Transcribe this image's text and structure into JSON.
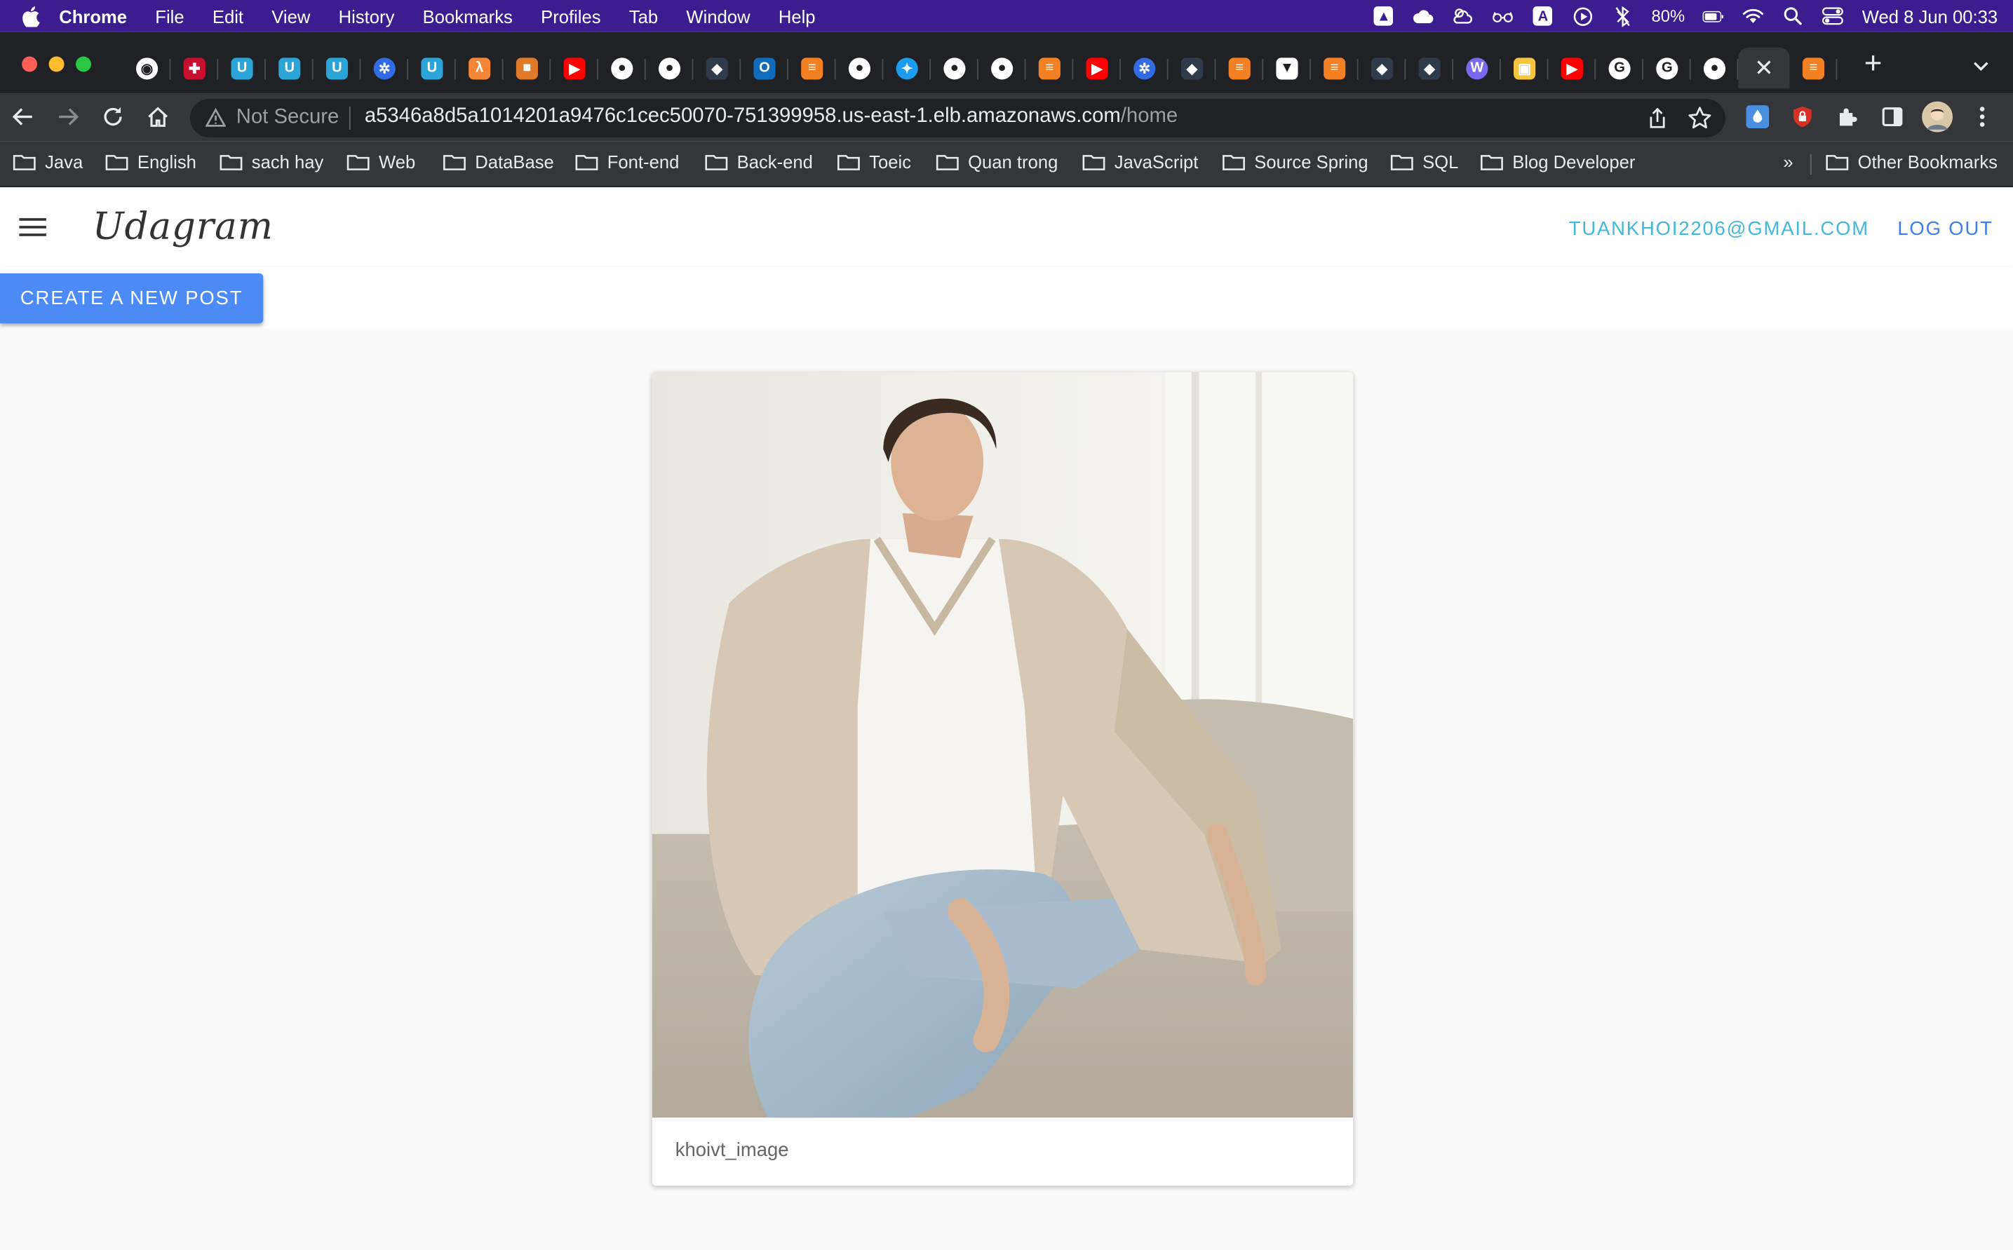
{
  "menubar": {
    "app": "Chrome",
    "items": [
      "File",
      "Edit",
      "View",
      "History",
      "Bookmarks",
      "Profiles",
      "Tab",
      "Window",
      "Help"
    ],
    "battery": "80%",
    "datetime": "Wed 8 Jun  00:33"
  },
  "tabs": [
    {
      "icon": "chrome-icon",
      "color": "#ffffff"
    },
    {
      "icon": "uk-flag-icon",
      "color": "#c8102e"
    },
    {
      "icon": "udacity-icon",
      "color": "#2ba4d8"
    },
    {
      "icon": "udacity-icon",
      "color": "#2ba4d8"
    },
    {
      "icon": "udacity-icon",
      "color": "#2ba4d8"
    },
    {
      "icon": "kubernetes-icon",
      "color": "#326ce5"
    },
    {
      "icon": "udacity-icon",
      "color": "#2ba4d8"
    },
    {
      "icon": "aws-lambda-icon",
      "color": "#f58536"
    },
    {
      "icon": "aws-box-icon",
      "color": "#e07a2b"
    },
    {
      "icon": "youtube-icon",
      "color": "#ff0000"
    },
    {
      "icon": "github-icon",
      "color": "#ffffff"
    },
    {
      "icon": "github-icon",
      "color": "#ffffff"
    },
    {
      "icon": "docker-icon",
      "color": "#2f3b4a"
    },
    {
      "icon": "outlook-icon",
      "color": "#0f6cbd"
    },
    {
      "icon": "stackoverflow-icon",
      "color": "#f48024"
    },
    {
      "icon": "github-icon",
      "color": "#ffffff"
    },
    {
      "icon": "bird-icon",
      "color": "#1d9bf0"
    },
    {
      "icon": "github-icon",
      "color": "#ffffff"
    },
    {
      "icon": "github-icon",
      "color": "#ffffff"
    },
    {
      "icon": "stackoverflow-icon",
      "color": "#f48024"
    },
    {
      "icon": "youtube-icon",
      "color": "#ff0000"
    },
    {
      "icon": "kubernetes-icon",
      "color": "#326ce5"
    },
    {
      "icon": "docker-icon",
      "color": "#2f3b4a"
    },
    {
      "icon": "stackoverflow-icon",
      "color": "#f48024"
    },
    {
      "icon": "vercel-icon",
      "color": "#ffffff"
    },
    {
      "icon": "stackoverflow-icon",
      "color": "#f48024"
    },
    {
      "icon": "docker-icon",
      "color": "#2f3b4a"
    },
    {
      "icon": "docker-icon",
      "color": "#2f3b4a"
    },
    {
      "icon": "wordpress-icon",
      "color": "#7b68ee"
    },
    {
      "icon": "package-icon",
      "color": "#f5c542"
    },
    {
      "icon": "youtube-icon",
      "color": "#ff0000"
    },
    {
      "icon": "google-icon",
      "color": "#ffffff"
    },
    {
      "icon": "google-icon",
      "color": "#ffffff"
    },
    {
      "icon": "github-icon",
      "color": "#ffffff"
    },
    {
      "icon": "close-icon",
      "color": "#e8eaed",
      "active": true
    },
    {
      "icon": "stackoverflow-icon",
      "color": "#f48024"
    }
  ],
  "address_bar": {
    "security": "Not Secure",
    "host": "a5346a8d5a1014201a9476c1cec50070-751399958.us-east-1.elb.amazonaws.com",
    "path": "/home"
  },
  "bookmarks": [
    "Java",
    "English",
    "sach hay",
    "Web",
    "DataBase",
    "Font-end",
    "Back-end",
    "Toeic",
    "Quan trong",
    "JavaScript",
    "Source Spring",
    "SQL",
    "Blog Developer"
  ],
  "bookmarks_more": "»",
  "bookmarks_other": "Other Bookmarks",
  "app": {
    "brand": "Udagram",
    "user_email": "TUANKHOI2206@GMAIL.COM",
    "logout_label": "LOG OUT",
    "create_label": "CREATE A NEW POST",
    "accent": "#4c8bf5",
    "email_color": "#43b8d8"
  },
  "feed": [
    {
      "caption": "khoivt_image"
    }
  ]
}
